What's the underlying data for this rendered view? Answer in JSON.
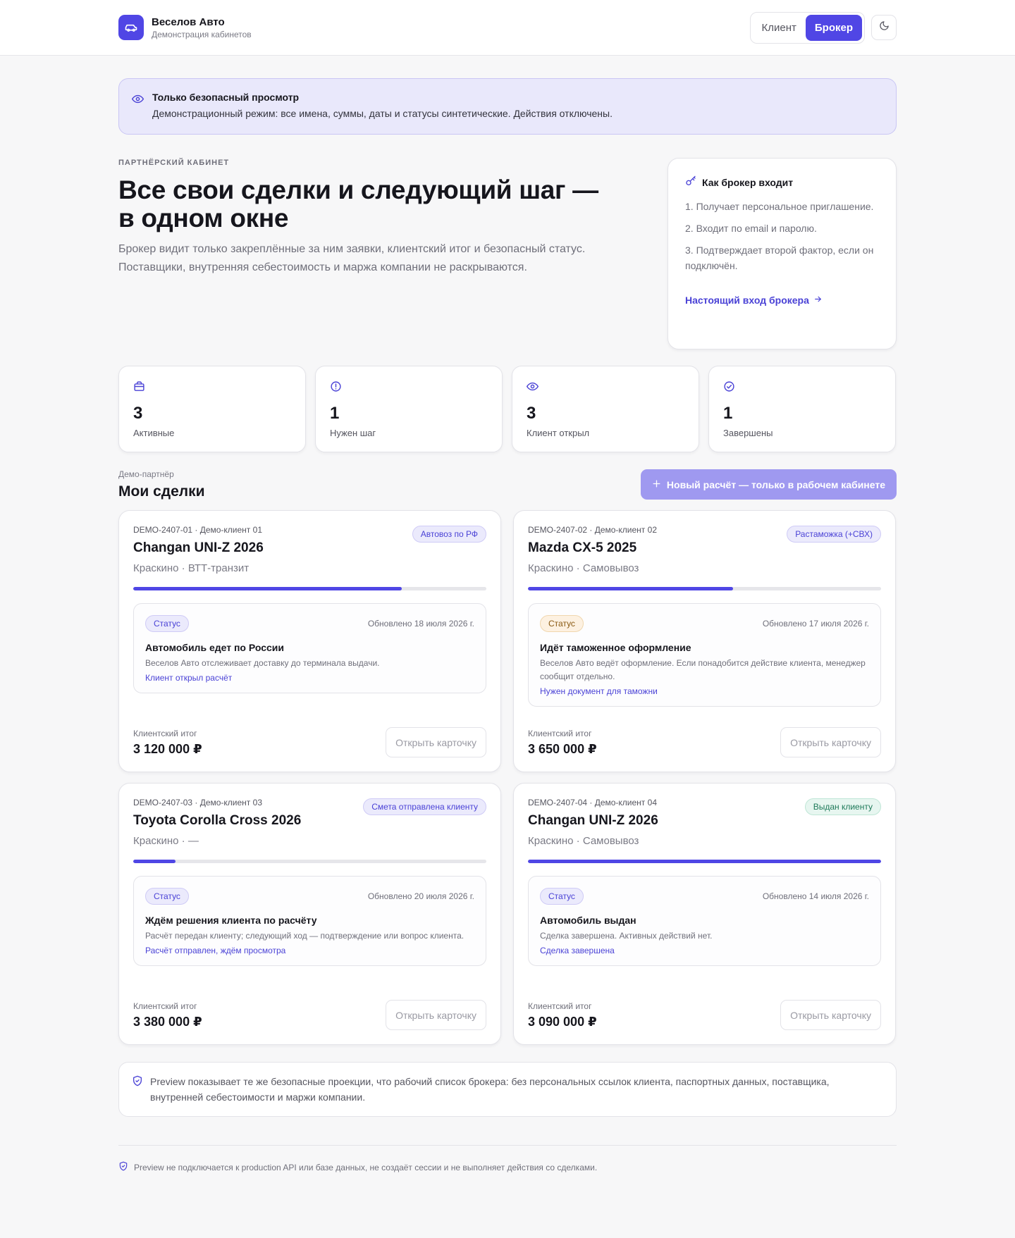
{
  "brand": {
    "name": "Веселов Авто",
    "subtitle": "Демонстрация кабинетов"
  },
  "roles": {
    "client": "Клиент",
    "broker": "Брокер",
    "active": "Брокер"
  },
  "banner": {
    "title": "Только безопасный просмотр",
    "text": "Демонстрационный режим: все имена, суммы, даты и статусы синтетические. Действия отключены."
  },
  "hero": {
    "eyebrow": "ПАРТНЁРСКИЙ КАБИНЕТ",
    "title": "Все свои сделки и следующий шаг — в одном окне",
    "description": "Брокер видит только закреплённые за ним заявки, клиентский итог и безопасный статус. Поставщики, внутренняя себестоимость и маржа компании не раскрываются."
  },
  "howto": {
    "title": "Как брокер входит",
    "steps": [
      "1. Получает персональное приглашение.",
      "2. Входит по email и паролю.",
      "3. Подтверждает второй фактор, если он подключён."
    ],
    "link": "Настоящий вход брокера"
  },
  "stats": [
    {
      "icon": "briefcase-icon",
      "value": "3",
      "label": "Активные"
    },
    {
      "icon": "alert-circle-icon",
      "value": "1",
      "label": "Нужен шаг"
    },
    {
      "icon": "eye-icon",
      "value": "3",
      "label": "Клиент открыл"
    },
    {
      "icon": "check-circle-icon",
      "value": "1",
      "label": "Завершены"
    }
  ],
  "deals_section": {
    "owner": "Демо-партнёр",
    "title": "Мои сделки",
    "new_button": "Новый расчёт — только в рабочем кабинете"
  },
  "deals": [
    {
      "id": "DEMO-2407-01 · Демо-клиент 01",
      "title": "Changan UNI-Z 2026",
      "route": "Краскино · ВТТ-транзит",
      "badge": "Автовоз по РФ",
      "progress": 0.76,
      "status_label": "Статус",
      "status_updated": "Обновлено 18 июля 2026 г.",
      "status_title": "Автомобиль едет по России",
      "status_desc": "Веселов Авто отслеживает доставку до терминала выдачи.",
      "status_link": "Клиент открыл расчёт",
      "total_label": "Клиентский итог",
      "total": "3 120 000 ₽",
      "open_button": "Открыть карточку"
    },
    {
      "id": "DEMO-2407-02 · Демо-клиент 02",
      "title": "Mazda CX-5 2025",
      "route": "Краскино · Самовывоз",
      "badge": "Растаможка (+СВХ)",
      "progress": 0.58,
      "status_label": "Статус",
      "status_updated": "Обновлено 17 июля 2026 г.",
      "status_title": "Идёт таможенное оформление",
      "status_desc": "Веселов Авто ведёт оформление. Если понадобится действие клиента, менеджер сообщит отдельно.",
      "status_link": "Нужен документ для таможни",
      "total_label": "Клиентский итог",
      "total": "3 650 000 ₽",
      "open_button": "Открыть карточку"
    },
    {
      "id": "DEMO-2407-03 · Демо-клиент 03",
      "title": "Toyota Corolla Cross 2026",
      "route": "Краскино · —",
      "badge": "Смета отправлена клиенту",
      "progress": 0.12,
      "status_label": "Статус",
      "status_updated": "Обновлено 20 июля 2026 г.",
      "status_title": "Ждём решения клиента по расчёту",
      "status_desc": "Расчёт передан клиенту; следующий ход — подтверждение или вопрос клиента.",
      "status_link": "Расчёт отправлен, ждём просмотра",
      "total_label": "Клиентский итог",
      "total": "3 380 000 ₽",
      "open_button": "Открыть карточку"
    },
    {
      "id": "DEMO-2407-04 · Демо-клиент 04",
      "title": "Changan UNI-Z 2026",
      "route": "Краскино · Самовывоз",
      "badge": "Выдан клиенту",
      "progress": 1.0,
      "status_label": "Статус",
      "status_updated": "Обновлено 14 июля 2026 г.",
      "status_title": "Автомобиль выдан",
      "status_desc": "Сделка завершена. Активных действий нет.",
      "status_link": "Сделка завершена",
      "total_label": "Клиентский итог",
      "total": "3 090 000 ₽",
      "open_button": "Открыть карточку"
    }
  ],
  "note": "Preview показывает те же безопасные проекции, что рабочий список брокера: без персональных ссылок клиента, паспортных данных, поставщика, внутренней себестоимости и маржи компании.",
  "footer": "Preview не подключается к production API или базе данных, не создаёт сессии и не выполняет действия со сделками.",
  "colors": {
    "accent": "#5046e5",
    "accent_light": "#9f99f0",
    "banner_bg": "#e9e8fb"
  }
}
